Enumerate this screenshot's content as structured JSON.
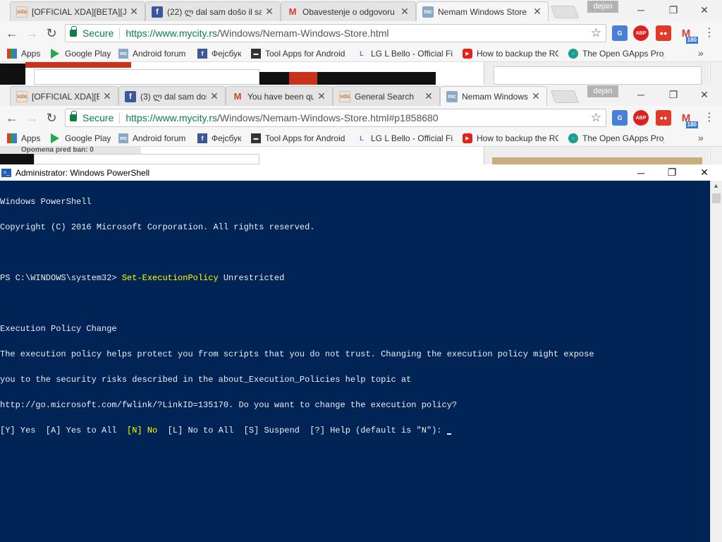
{
  "browser_back": {
    "tabs": [
      {
        "favicon": "xda",
        "title": "[OFFICIAL XDA][BETA][JA"
      },
      {
        "favicon": "fb",
        "title": "(22) ლ dal sam došo il sa"
      },
      {
        "favicon": "gmail",
        "title": "Obavestenje o odgovoru"
      },
      {
        "favicon": "mc",
        "title": "Nemam Windows Store"
      }
    ],
    "user": "dejan",
    "secure_label": "Secure",
    "url_host": "https://www.mycity.rs",
    "url_path": "/Windows/Nemam-Windows-Store.html"
  },
  "browser_front": {
    "tabs": [
      {
        "favicon": "xda",
        "title": "[OFFICIAL XDA][BE"
      },
      {
        "favicon": "fb",
        "title": "(3) ლ dal sam doš"
      },
      {
        "favicon": "gmail",
        "title": "You have been qu"
      },
      {
        "favicon": "xda",
        "title": "General Search"
      },
      {
        "favicon": "mc",
        "title": "Nemam Windows"
      }
    ],
    "user": "dejan",
    "secure_label": "Secure",
    "url_host": "https://www.mycity.rs",
    "url_path": "/Windows/Nemam-Windows-Store.html#p1858680",
    "peek_text": "Opomena pred ban: 0"
  },
  "bookmarks": [
    {
      "icon": "apps",
      "label": "Apps"
    },
    {
      "icon": "google-play",
      "label": "Google Play"
    },
    {
      "icon": "android-forum",
      "label": "Android forum"
    },
    {
      "icon": "facebook",
      "label": "Фејсбук"
    },
    {
      "icon": "tool-apps",
      "label": "Tool Apps for Android"
    },
    {
      "icon": "lg",
      "label": "LG L Bello - Official Fi"
    },
    {
      "icon": "youtube",
      "label": "How to backup the RO"
    },
    {
      "icon": "opengapps",
      "label": "The Open GApps Proj"
    }
  ],
  "extensions": {
    "abp": "ABP",
    "gmail_badge": "180"
  },
  "powershell": {
    "title": "Administrator: Windows PowerShell",
    "lines": {
      "l1": "Windows PowerShell",
      "l2": "Copyright (C) 2016 Microsoft Corporation. All rights reserved.",
      "prompt": "PS C:\\WINDOWS\\system32> ",
      "command": "Set-ExecutionPolicy",
      "argument": " Unrestricted",
      "l5": "Execution Policy Change",
      "l6": "The execution policy helps protect you from scripts that you do not trust. Changing the execution policy might expose",
      "l7": "you to the security risks described in the about_Execution_Policies help topic at",
      "l8": "http://go.microsoft.com/fwlink/?LinkID=135170. Do you want to change the execution policy?",
      "opt_a": "[Y] Yes  [A] Yes to All  ",
      "opt_b": "[N] No",
      "opt_c": "  [L] No to All  [S] Suspend  [?] Help (default is \"N\"): "
    }
  },
  "colors": {
    "console_bg": "#012456",
    "console_fg": "#eeedf0",
    "console_highlight": "#ffff00",
    "secure_green": "#0b8043"
  }
}
